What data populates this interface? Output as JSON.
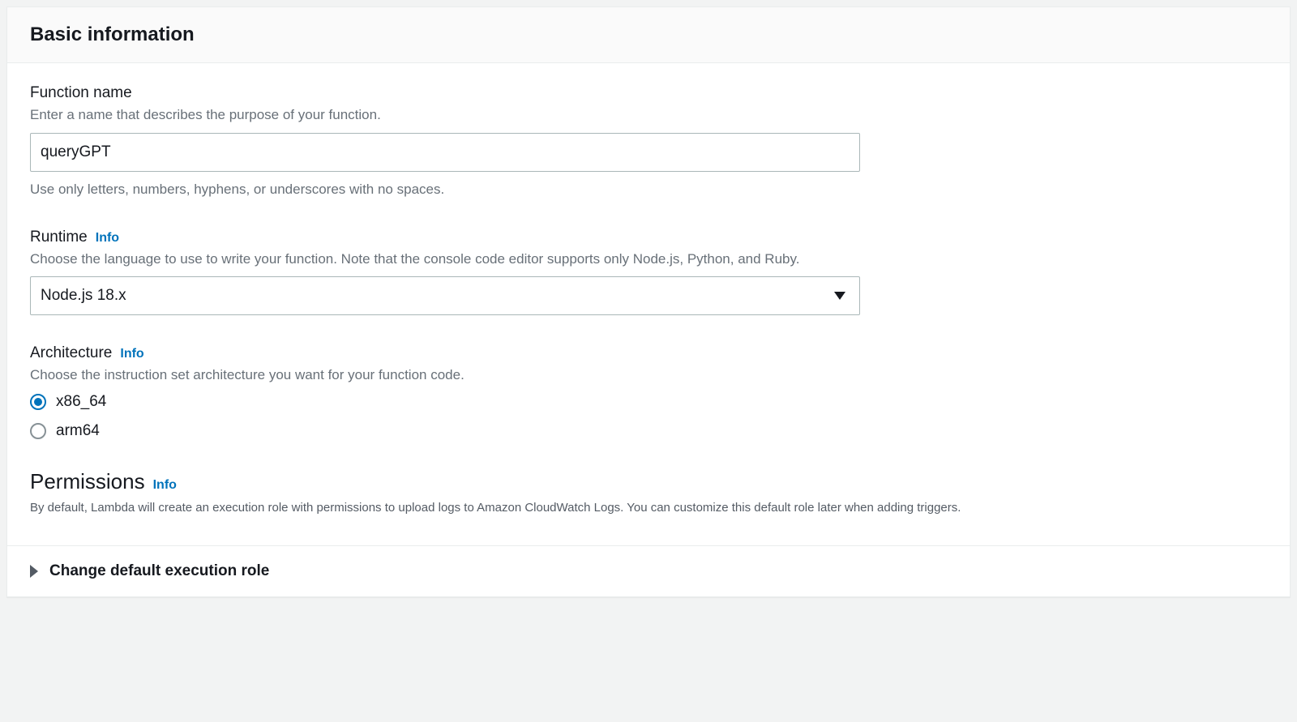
{
  "panel": {
    "title": "Basic information"
  },
  "functionName": {
    "label": "Function name",
    "description": "Enter a name that describes the purpose of your function.",
    "value": "queryGPT",
    "constraint": "Use only letters, numbers, hyphens, or underscores with no spaces."
  },
  "runtime": {
    "label": "Runtime",
    "infoLabel": "Info",
    "description": "Choose the language to use to write your function. Note that the console code editor supports only Node.js, Python, and Ruby.",
    "selected": "Node.js 18.x"
  },
  "architecture": {
    "label": "Architecture",
    "infoLabel": "Info",
    "description": "Choose the instruction set architecture you want for your function code.",
    "options": [
      {
        "value": "x86_64",
        "selected": true
      },
      {
        "value": "arm64",
        "selected": false
      }
    ]
  },
  "permissions": {
    "label": "Permissions",
    "infoLabel": "Info",
    "description": "By default, Lambda will create an execution role with permissions to upload logs to Amazon CloudWatch Logs. You can customize this default role later when adding triggers."
  },
  "expander": {
    "label": "Change default execution role"
  }
}
